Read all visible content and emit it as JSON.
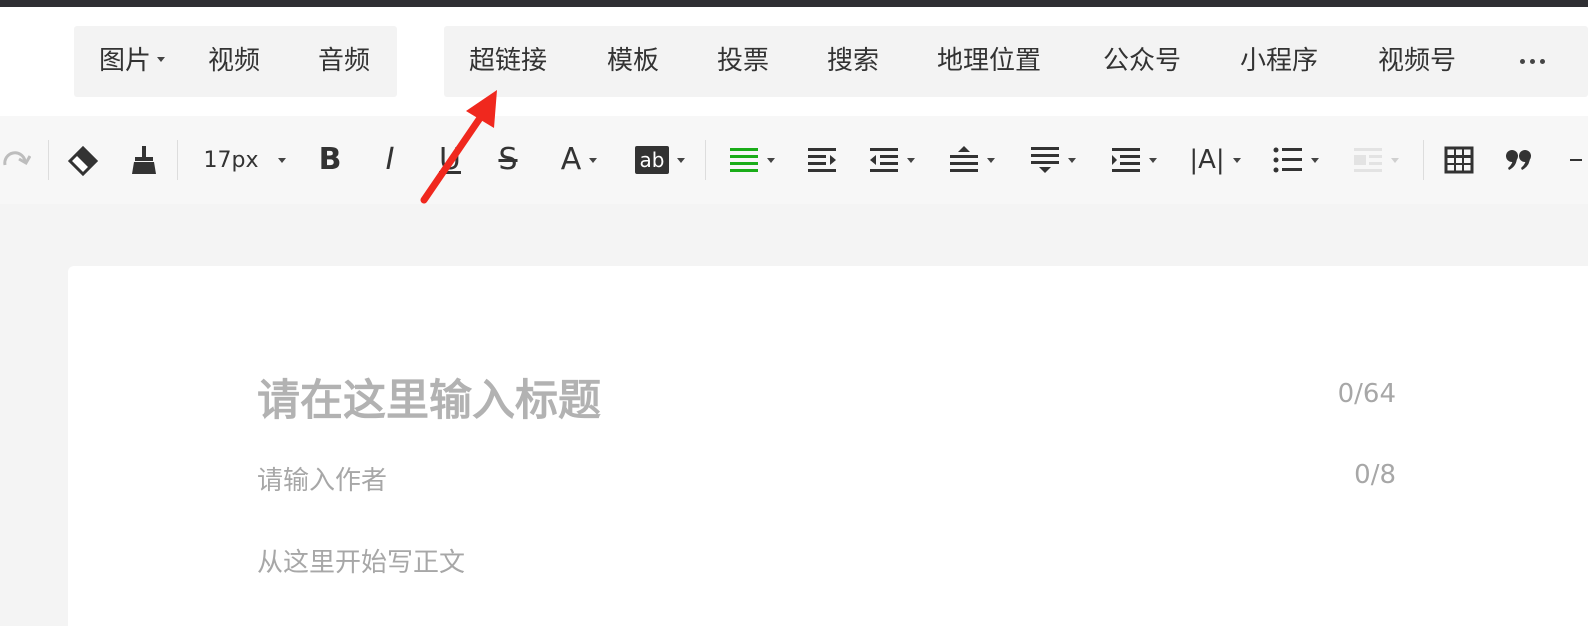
{
  "insert_menu": {
    "media": [
      {
        "label": "图片",
        "has_dropdown": true
      },
      {
        "label": "视频"
      },
      {
        "label": "音频"
      }
    ],
    "components": [
      {
        "label": "超链接"
      },
      {
        "label": "模板"
      },
      {
        "label": "投票"
      },
      {
        "label": "搜索"
      },
      {
        "label": "地理位置"
      },
      {
        "label": "公众号"
      },
      {
        "label": "小程序"
      },
      {
        "label": "视频号"
      }
    ],
    "more_icon": "more-dots-icon"
  },
  "toolbar": {
    "font_size": "17px",
    "bold": "B",
    "italic": "I",
    "underline": "U",
    "strike": "S",
    "font_color": "A",
    "bg_color": "ab",
    "letter_spacing": "|A|",
    "align_color": "#1aad19",
    "icons": [
      "redo-icon",
      "eraser-icon",
      "format-brush-icon",
      "bold-icon",
      "italic-icon",
      "underline-icon",
      "strikethrough-icon",
      "font-color-icon",
      "background-color-icon",
      "align-justify-icon",
      "indent-icon",
      "outdent-icon",
      "line-height-icon",
      "paragraph-spacing-icon",
      "margin-icon",
      "letter-spacing-icon",
      "list-icon",
      "image-float-icon",
      "table-icon",
      "quote-icon"
    ]
  },
  "editor": {
    "title_placeholder": "请在这里输入标题",
    "title_count": "0/64",
    "author_placeholder": "请输入作者",
    "author_count": "0/8",
    "body_placeholder": "从这里开始写正文"
  },
  "annotation": {
    "arrow_color": "#f0281e"
  }
}
